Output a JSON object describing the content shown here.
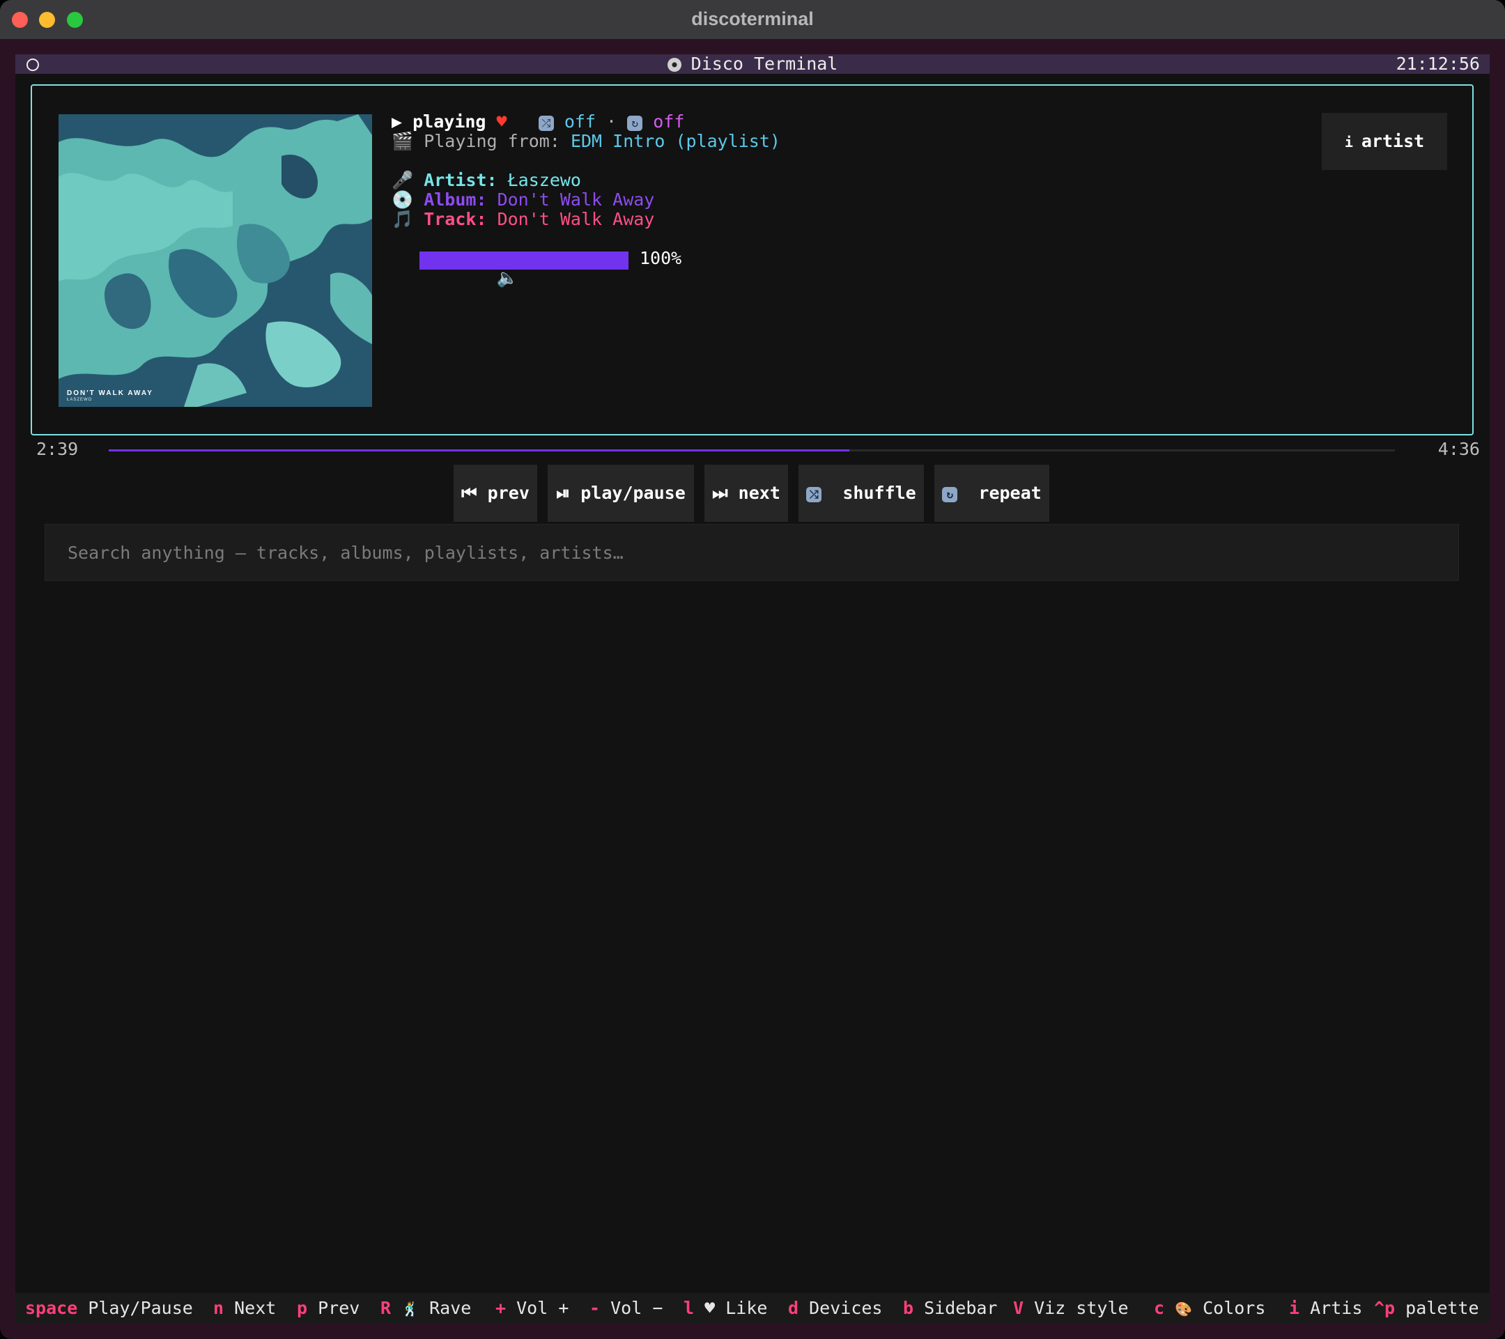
{
  "window": {
    "title": "discoterminal"
  },
  "header": {
    "title": "Disco Terminal",
    "clock": "21:12:56"
  },
  "now_playing": {
    "state_icon": "▶",
    "state": "playing",
    "liked_icon": "♥",
    "shuffle_value": "off",
    "separator": "·",
    "repeat_value": "off",
    "source_label": "Playing from:",
    "source_value": "EDM Intro (playlist)",
    "artist_label": "Artist:",
    "artist_value": "Łaszewo",
    "album_label": "Album:",
    "album_value": "Don't Walk Away",
    "track_label": "Track:",
    "track_value": "Don't Walk Away",
    "volume_percent": 100,
    "volume_label": "100%"
  },
  "cover": {
    "title": "DON'T WALK AWAY",
    "subtitle": "ŁASZEWO"
  },
  "artist_button": {
    "icon": "i",
    "label": "artist"
  },
  "progress": {
    "elapsed": "2:39",
    "total": "4:36",
    "fraction": 0.576
  },
  "controls": {
    "prev": "⏮ prev",
    "play_pause": "⏯ play/pause",
    "next": "⏭ next",
    "shuffle": "shuffle",
    "repeat": "repeat"
  },
  "search": {
    "placeholder": "Search anything — tracks, albums, playlists, artists…"
  },
  "footer": [
    {
      "key": "space",
      "label": "Play/Pause"
    },
    {
      "key": "n",
      "label": "Next"
    },
    {
      "key": "p",
      "label": "Prev"
    },
    {
      "key": "R",
      "label": "Rave"
    },
    {
      "key": "+",
      "label": "Vol +"
    },
    {
      "key": "-",
      "label": "Vol −"
    },
    {
      "key": "l",
      "label": "♥ Like"
    },
    {
      "key": "d",
      "label": "Devices"
    },
    {
      "key": "b",
      "label": "Sidebar"
    },
    {
      "key": "V",
      "label": "Viz style"
    },
    {
      "key": "c",
      "label": "Colors"
    },
    {
      "key": "i",
      "label": "Artis"
    },
    {
      "key": "^p",
      "label": "palette"
    }
  ],
  "colors": {
    "accent": "#7133ee",
    "border": "#7fe1e3",
    "key": "#ff3f7a"
  }
}
